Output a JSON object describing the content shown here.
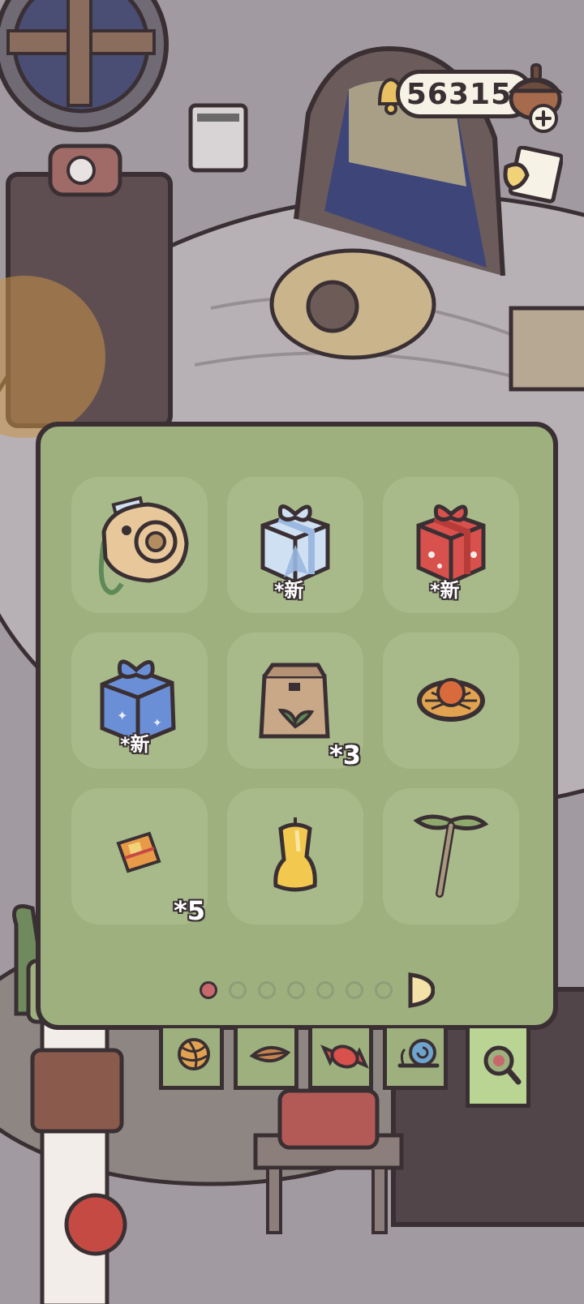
{
  "currency": {
    "coins": "56315",
    "add_icon": "plus-icon"
  },
  "inventory": {
    "slots": [
      {
        "name": "instant-camera",
        "icon": "camera-icon",
        "badge": ""
      },
      {
        "name": "blue-gift-box",
        "icon": "gift-box-icon",
        "badge": "*新"
      },
      {
        "name": "red-gift-box",
        "icon": "gift-box-icon",
        "badge": "*新"
      },
      {
        "name": "blue-star-gift-box",
        "icon": "gift-box-icon",
        "badge": "*新"
      },
      {
        "name": "seed-bag",
        "icon": "seed-bag-icon",
        "badge": "*3"
      },
      {
        "name": "hat",
        "icon": "hat-icon",
        "badge": ""
      },
      {
        "name": "ticket",
        "icon": "ticket-icon",
        "badge": "*5"
      },
      {
        "name": "yellow-candle",
        "icon": "candle-icon",
        "badge": ""
      },
      {
        "name": "bamboo-copter",
        "icon": "bamboo-copter-icon",
        "badge": ""
      }
    ],
    "current_page": 1,
    "total_pages": 7
  },
  "tabs": [
    {
      "name": "yarn",
      "icon": "yarn-ball-icon"
    },
    {
      "name": "leaf",
      "icon": "leaf-icon"
    },
    {
      "name": "candy",
      "icon": "candy-icon"
    },
    {
      "name": "snail",
      "icon": "snail-icon"
    },
    {
      "name": "search",
      "icon": "magnifier-icon",
      "active": true
    }
  ],
  "colors": {
    "panel": "#9db07e",
    "outline": "#3a3034",
    "active_dot": "#c9686c"
  }
}
